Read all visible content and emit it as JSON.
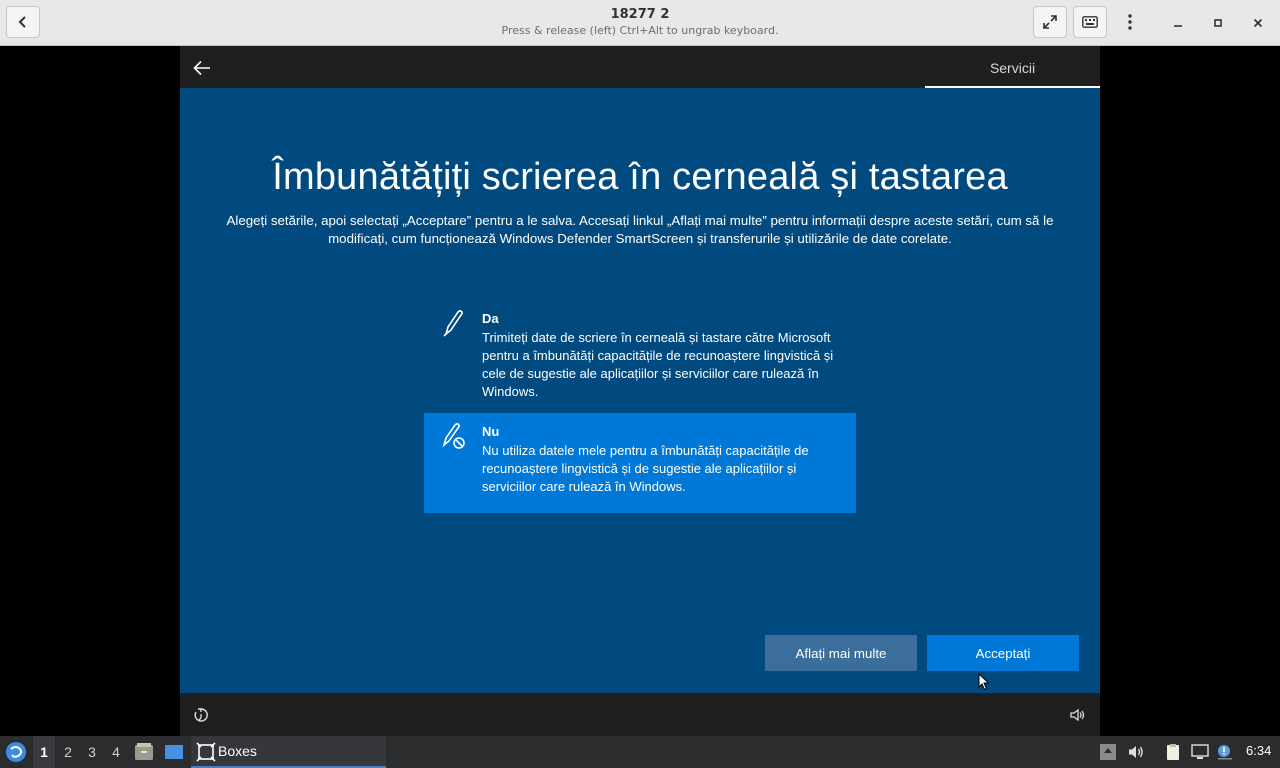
{
  "header": {
    "title": "18277 2",
    "subtitle": "Press & release (left) Ctrl+Alt to ungrab keyboard."
  },
  "vm": {
    "tab_label": "Servicii",
    "headline": "Îmbunătățiți scrierea în cerneală și tastarea",
    "description": "Alegeți setările, apoi selectați „Acceptare” pentru a le salva. Accesați linkul „Aflați mai multe” pentru informații despre aceste setări, cum să le modificați, cum funcționează Windows Defender SmartScreen și transferurile și utilizările de date corelate.",
    "options": [
      {
        "title": "Da",
        "description": "Trimiteți date de scriere în cerneală și tastare către Microsoft pentru a îmbunătăți capacitățile de recunoaștere lingvistică și cele de sugestie ale aplicațiilor și serviciilor care rulează în Windows.",
        "icon": "pen-icon",
        "selected": false
      },
      {
        "title": "Nu",
        "description": "Nu utiliza datele mele pentru a îmbunătăți capacitățile de recunoaștere lingvistică și de sugestie ale aplicațiilor și serviciilor care rulează în Windows.",
        "icon": "pen-blocked-icon",
        "selected": true
      }
    ],
    "learn_more_label": "Aflați mai multe",
    "accept_label": "Acceptați",
    "colors": {
      "background": "#004a7f",
      "selected_option": "#0078d7",
      "accept_button": "#0078d7",
      "learn_more_button": "#3c6e9b"
    }
  },
  "taskbar": {
    "workspaces": [
      "1",
      "2",
      "3",
      "4"
    ],
    "active_workspace": "1",
    "task_label": "Boxes",
    "clock": "6:34"
  }
}
